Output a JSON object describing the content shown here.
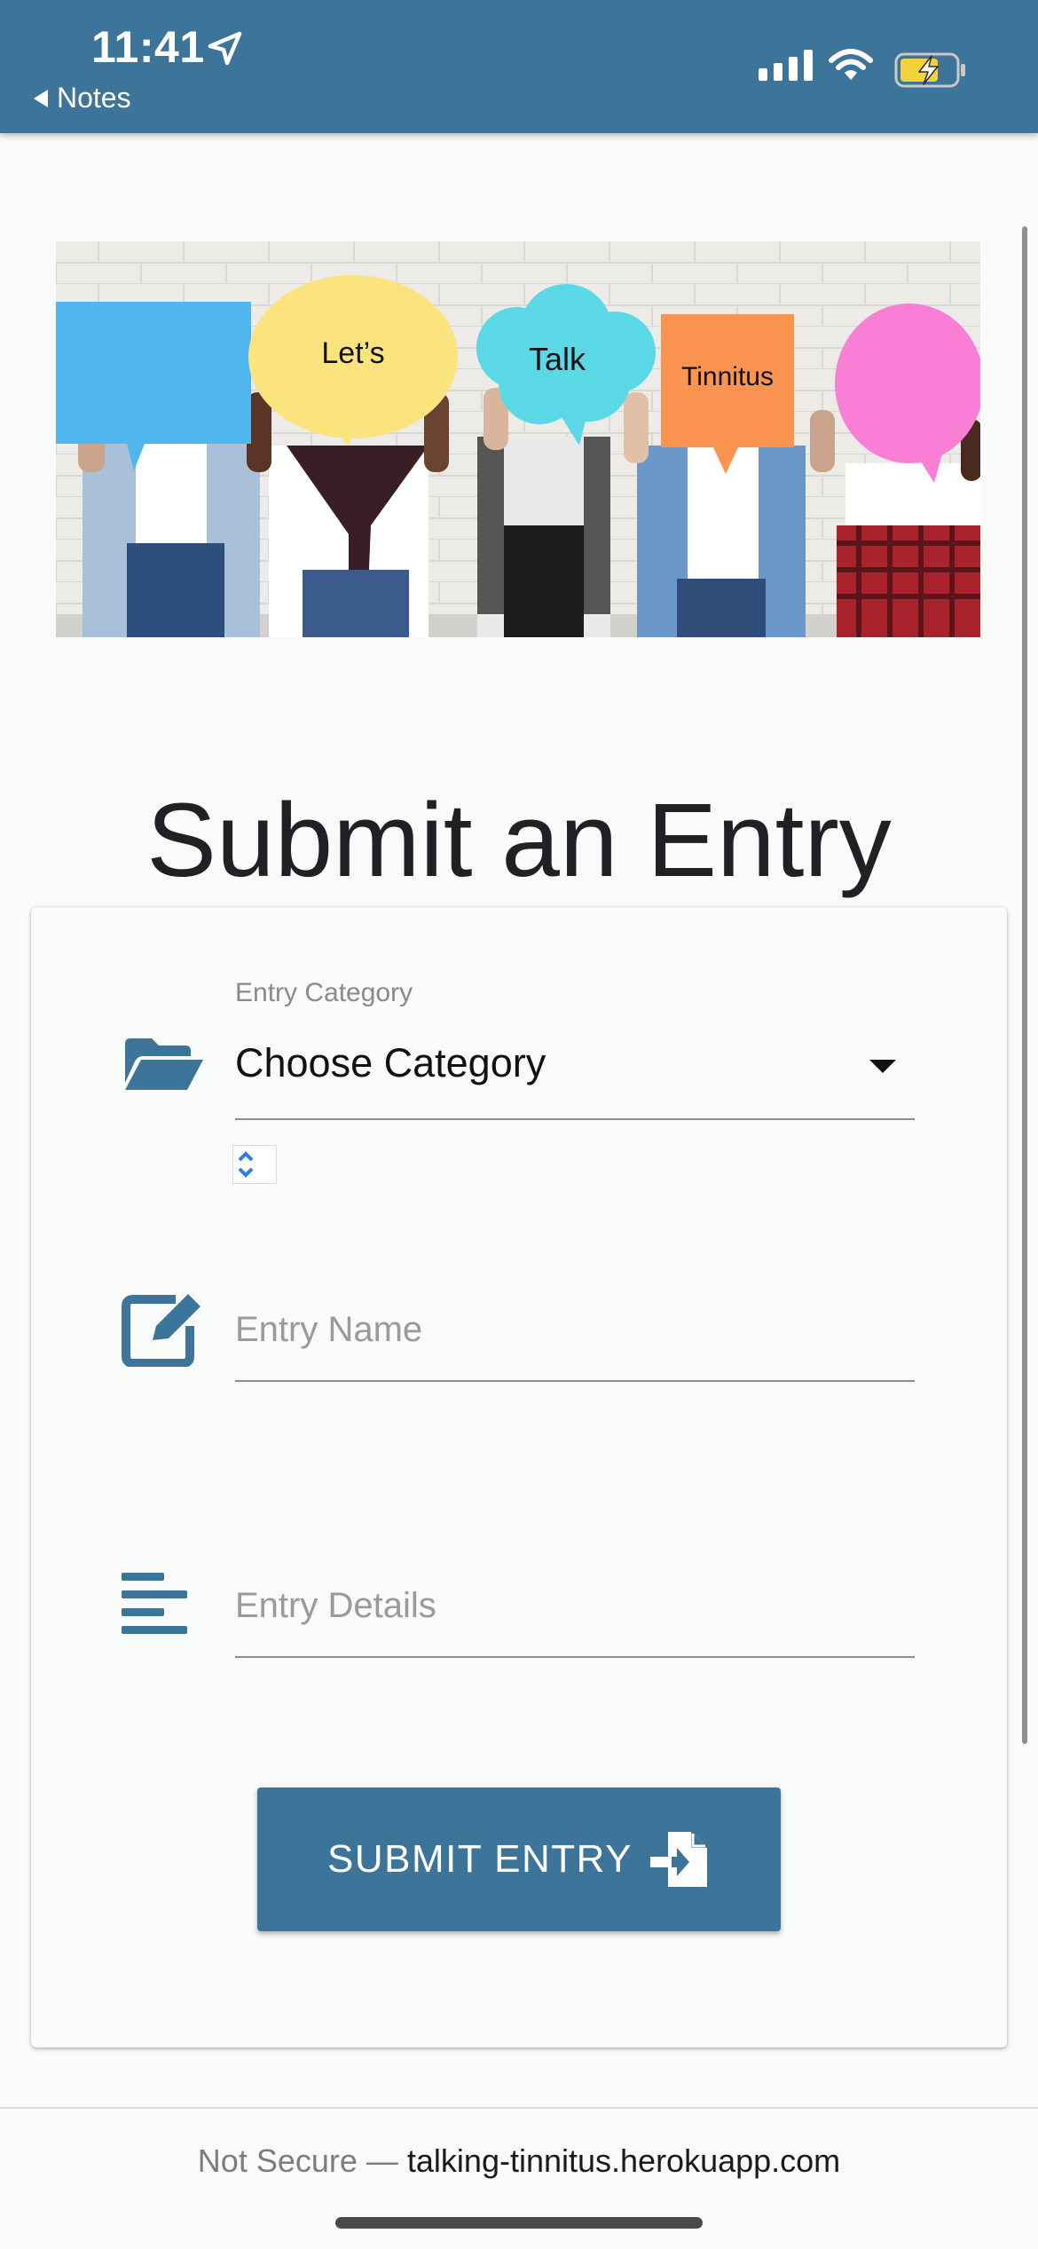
{
  "status_bar": {
    "time": "11:41",
    "back_app": "Notes",
    "icons": [
      "location-arrow-icon",
      "cellular-signal-icon",
      "wifi-icon",
      "battery-charging-icon"
    ],
    "color": "#3d7499"
  },
  "banner": {
    "bubbles": [
      "Let’s",
      "Talk",
      "Tinnitus"
    ]
  },
  "page": {
    "title": "Submit an Entry"
  },
  "form": {
    "category_label": "Entry Category",
    "category_value": "Choose Category",
    "name_placeholder": "Entry Name",
    "details_placeholder": "Entry Details",
    "submit_label": "SUBMIT ENTRY",
    "icons": [
      "folder-open-icon",
      "edit-icon",
      "align-left-icon",
      "file-import-icon"
    ]
  },
  "browser": {
    "security": "Not Secure —",
    "domain": "talking-tinnitus.herokuapp.com"
  },
  "colors": {
    "accent": "#3d7499",
    "background": "#f9fafa"
  }
}
